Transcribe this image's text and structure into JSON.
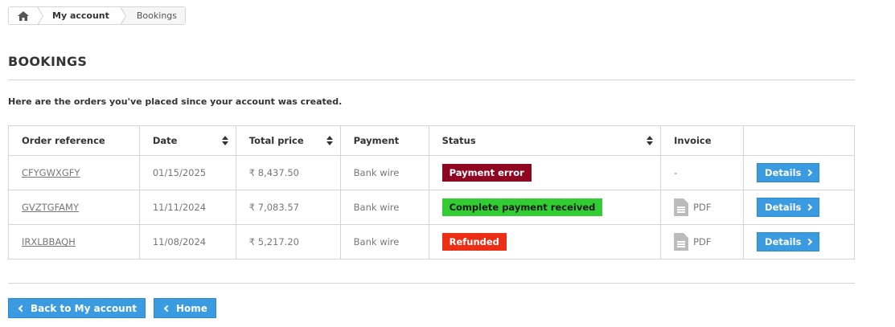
{
  "breadcrumb": {
    "home_icon": "home-icon",
    "items": [
      "My account",
      "Bookings"
    ]
  },
  "heading": "BOOKINGS",
  "intro": "Here are the orders you've placed since your account was created.",
  "table": {
    "headers": [
      "Order reference",
      "Date",
      "Total price",
      "Payment",
      "Status",
      "Invoice",
      ""
    ],
    "rows": [
      {
        "ref": "CFYGWXGFY",
        "date": "01/15/2025",
        "total": "₹ 8,437.50",
        "payment": "Bank wire",
        "status": "Payment error",
        "status_color": "#8f0621",
        "invoice": "-",
        "action": "Details"
      },
      {
        "ref": "GVZTGFAMY",
        "date": "11/11/2024",
        "total": "₹ 7,083.57",
        "payment": "Bank wire",
        "status": "Complete payment received",
        "status_color": "#32cd32",
        "invoice": "PDF",
        "action": "Details"
      },
      {
        "ref": "IRXLBBAQH",
        "date": "11/08/2024",
        "total": "₹ 5,217.20",
        "payment": "Bank wire",
        "status": "Refunded",
        "status_color": "#ec2e15",
        "invoice": "PDF",
        "action": "Details"
      }
    ]
  },
  "footer": {
    "back_label": "Back to My account",
    "home_label": "Home"
  },
  "colors": {
    "accent": "#3a9be0"
  }
}
